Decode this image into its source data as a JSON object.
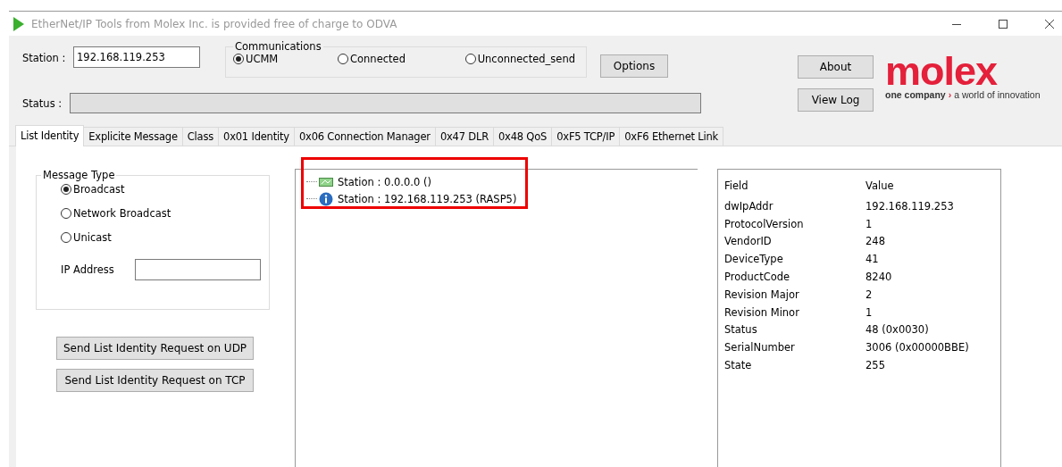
{
  "window": {
    "title": "EtherNet/IP Tools from Molex Inc. is provided free of charge to ODVA"
  },
  "station": {
    "label": "Station :",
    "value": "192.168.119.253"
  },
  "communications": {
    "title": "Communications",
    "options": [
      {
        "label": "UCMM",
        "selected": true
      },
      {
        "label": "Connected",
        "selected": false
      },
      {
        "label": "Unconnected_send",
        "selected": false
      }
    ]
  },
  "options_button": "Options",
  "side_buttons": [
    "About",
    "View Log"
  ],
  "logo": {
    "wordmark": "molex",
    "tagline_left": "one company",
    "separator": "›",
    "tagline_right": "a world of innovation"
  },
  "status": {
    "label": "Status :"
  },
  "tabs": [
    {
      "label": "List Identity",
      "selected": true
    },
    {
      "label": "Explicite Message",
      "selected": false
    },
    {
      "label": "Class",
      "selected": false
    },
    {
      "label": "0x01 Identity",
      "selected": false
    },
    {
      "label": "0x06 Connection Manager",
      "selected": false
    },
    {
      "label": "0x47 DLR",
      "selected": false
    },
    {
      "label": "0x48 QoS",
      "selected": false
    },
    {
      "label": "0xF5 TCP/IP",
      "selected": false
    },
    {
      "label": "0xF6 Ethernet Link",
      "selected": false
    }
  ],
  "message_type": {
    "title": "Message Type",
    "options": [
      {
        "label": "Broadcast",
        "selected": true
      },
      {
        "label": "Network Broadcast",
        "selected": false
      },
      {
        "label": "Unicast",
        "selected": false
      }
    ],
    "ip_label": "IP Address"
  },
  "send_buttons": [
    "Send List Identity Request on UDP",
    "Send List Identity Request on TCP"
  ],
  "tree": {
    "highlighted": true,
    "items": [
      {
        "text": "Station : 0.0.0.0 ()",
        "kind": "network"
      },
      {
        "text": "Station : 192.168.119.253 (RASP5)",
        "kind": "info"
      }
    ]
  },
  "details": {
    "columns": [
      "Field",
      "Value"
    ],
    "rows": [
      [
        "dwIpAddr",
        "192.168.119.253"
      ],
      [
        "ProtocolVersion",
        "1"
      ],
      [
        "VendorID",
        "248"
      ],
      [
        "DeviceType",
        "41"
      ],
      [
        "ProductCode",
        "8240"
      ],
      [
        "Revision Major",
        "2"
      ],
      [
        "Revision Minor",
        "1"
      ],
      [
        "Status",
        "48 (0x0030)"
      ],
      [
        "SerialNumber",
        "3006 (0x00000BBE)"
      ],
      [
        "State",
        "255"
      ]
    ]
  }
}
